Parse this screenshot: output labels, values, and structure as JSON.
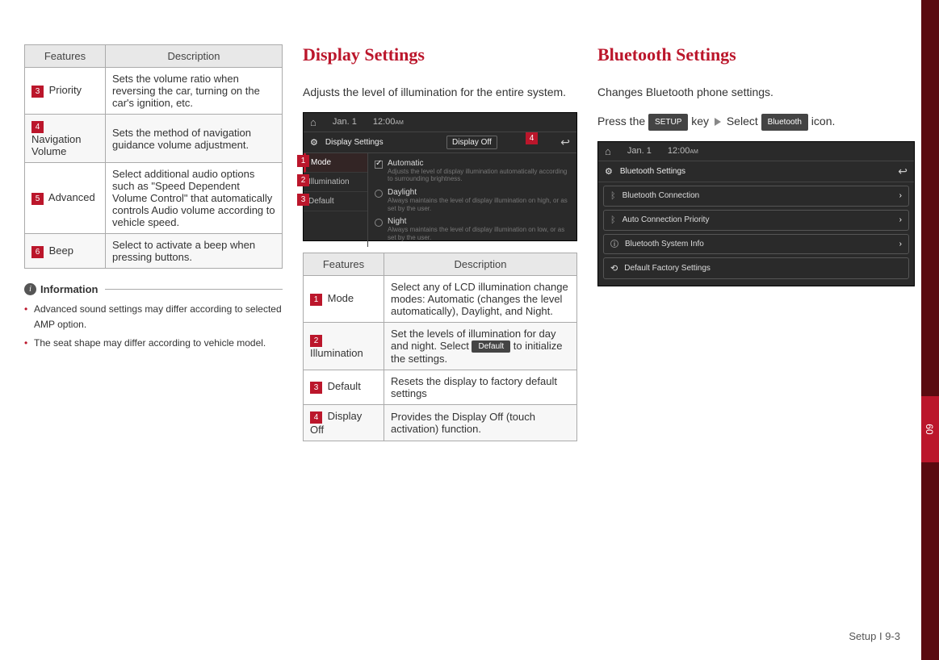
{
  "col1": {
    "table": {
      "headers": [
        "Features",
        "Description"
      ],
      "rows": [
        {
          "num": "3",
          "feature": "Priority",
          "desc": "Sets the volume ratio when reversing the car, turning on the car's ignition, etc."
        },
        {
          "num": "4",
          "feature": "Navigation Volume",
          "desc": "Sets the method of navigation guidance volume adjustment."
        },
        {
          "num": "5",
          "feature": "Advanced",
          "desc": "Select additional audio options such as \"Speed Dependent Volume Control\" that automatically controls Audio volume according to vehicle speed."
        },
        {
          "num": "6",
          "feature": "Beep",
          "desc": "Select to activate a beep when pressing buttons."
        }
      ]
    },
    "info_title": "Information",
    "info_items": [
      "Advanced sound settings may differ according to selected AMP option.",
      "The seat shape may differ according to vehicle model."
    ]
  },
  "col2": {
    "title": "Display Settings",
    "intro": "Adjusts the level of illumination for the entire system.",
    "screenshot": {
      "date": "Jan. 1",
      "time": "12:00",
      "ampm": "AM",
      "title": "Display Settings",
      "display_off": "Display Off",
      "sidebar": [
        "Mode",
        "Illumination",
        "Default"
      ],
      "callouts": [
        "1",
        "2",
        "3",
        "4"
      ],
      "options": [
        {
          "label": "Automatic",
          "desc": "Adjusts the level of display illumination automatically according to surrounding brightness.",
          "checked": true,
          "type": "check"
        },
        {
          "label": "Daylight",
          "desc": "Always maintains the level of display illumination on high, or as set by the user.",
          "type": "radio"
        },
        {
          "label": "Night",
          "desc": "Always maintains the level of display illumination on low, or as set by the user.",
          "type": "radio"
        }
      ]
    },
    "table": {
      "headers": [
        "Features",
        "Description"
      ],
      "rows": [
        {
          "num": "1",
          "feature": "Mode",
          "desc": "Select any of LCD illumination change modes: Automatic (changes the level automatically), Daylight, and Night."
        },
        {
          "num": "2",
          "feature": "Illumination",
          "desc_a": "Set the levels of illumination for day and night. Select ",
          "desc_key": "Default",
          "desc_b": " to initialize the settings."
        },
        {
          "num": "3",
          "feature": "Default",
          "desc": "Resets the display to factory default settings"
        },
        {
          "num": "4",
          "feature": "Display Off",
          "desc": "Provides the Display Off (touch activation) function."
        }
      ]
    }
  },
  "col3": {
    "title": "Bluetooth Settings",
    "intro_a": "Changes Bluetooth phone settings.",
    "intro_b_pre": "Press the ",
    "intro_b_key1": "SETUP",
    "intro_b_mid": " key ",
    "intro_b_sel": " Select ",
    "intro_b_key2": "Bluetooth",
    "intro_b_post": " icon.",
    "screenshot": {
      "date": "Jan. 1",
      "time": "12:00",
      "ampm": "AM",
      "title": "Bluetooth Settings",
      "items": [
        {
          "icon": "bt",
          "label": "Bluetooth Connection",
          "chev": true
        },
        {
          "icon": "bt",
          "label": "Auto Connection Priority",
          "chev": true
        },
        {
          "icon": "info",
          "label": "Bluetooth System Info",
          "chev": true
        },
        {
          "icon": "reset",
          "label": "Default Factory Settings",
          "chev": false
        }
      ]
    }
  },
  "tab_label": "09",
  "footer": "Setup I 9-3"
}
